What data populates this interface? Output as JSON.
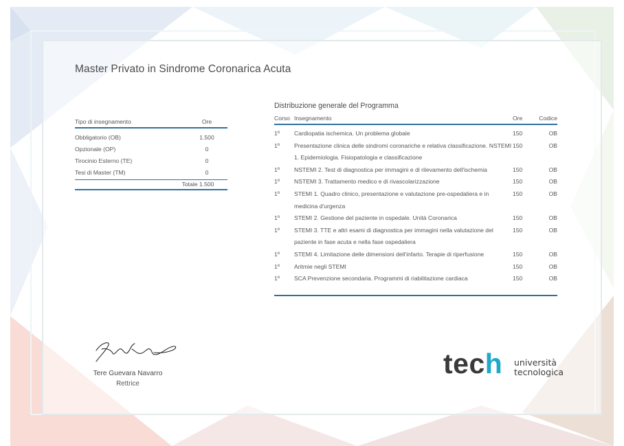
{
  "document": {
    "title": "Master Privato in Sindrome Coronarica Acuta"
  },
  "summary_table": {
    "header": {
      "type": "Tipo di insegnamento",
      "hours": "Ore"
    },
    "rows": [
      {
        "type": "Obbligatorio (OB)",
        "hours": "1.500"
      },
      {
        "type": "Opzionale (OP)",
        "hours": "0"
      },
      {
        "type": "Tirocinio Esterno (TE)",
        "hours": "0"
      },
      {
        "type": "Tesi di Master (TM)",
        "hours": "0"
      }
    ],
    "total": "Totale 1.500"
  },
  "program_table": {
    "caption": "Distribuzione generale del Programma",
    "header": {
      "course": "Corso",
      "subject": "Insegnamento",
      "hours": "Ore",
      "code": "Codice"
    },
    "rows": [
      {
        "course": "1º",
        "subject": "Cardiopatia ischemica. Un problema globale",
        "hours": "150",
        "code": "OB"
      },
      {
        "course": "1º",
        "subject": "Presentazione clinica delle sindromi coronariche e relativa classificazione. NSTEMI 1. Epidemiologia. Fisiopatologia e classificazione",
        "hours": "150",
        "code": "OB"
      },
      {
        "course": "1º",
        "subject": "NSTEMI 2. Test di diagnostica per immagini e di rilevamento dell'ischemia",
        "hours": "150",
        "code": "OB"
      },
      {
        "course": "1º",
        "subject": "NSTEMI 3. Trattamento medico e di rivascolarizzazione",
        "hours": "150",
        "code": "OB"
      },
      {
        "course": "1º",
        "subject": "STEMI 1. Quadro clinico, presentazione e valutazione pre-ospedaliera e in medicina d'urgenza",
        "hours": "150",
        "code": "OB"
      },
      {
        "course": "1º",
        "subject": "STEMI 2. Gestione del paziente in ospedale. Unità Coronarica",
        "hours": "150",
        "code": "OB"
      },
      {
        "course": "1º",
        "subject": "STEMI 3. TTE e altri esami di diagnostica per immagini nella valutazione del paziente in fase acuta e nella fase ospedaliera",
        "hours": "150",
        "code": "OB"
      },
      {
        "course": "1º",
        "subject": "STEMI 4. Limitazione delle dimensioni dell'infarto. Terapie di riperfusione",
        "hours": "150",
        "code": "OB"
      },
      {
        "course": "1º",
        "subject": "Aritmie negli STEMI",
        "hours": "150",
        "code": "OB"
      },
      {
        "course": "1º",
        "subject": "SCA Prevenzione secondaria. Programmi di riabilitazione cardiaca",
        "hours": "150",
        "code": "OB"
      }
    ]
  },
  "signatory": {
    "name": "Tere Guevara Navarro",
    "role": "Rettrice"
  },
  "logo": {
    "word_main": "tec",
    "word_accent": "h",
    "line1": "università",
    "line2": "tecnologica"
  },
  "colors": {
    "rule": "#2f6f9f",
    "logo_accent": "#1fa9c9",
    "logo_text": "#3a3a3a"
  }
}
